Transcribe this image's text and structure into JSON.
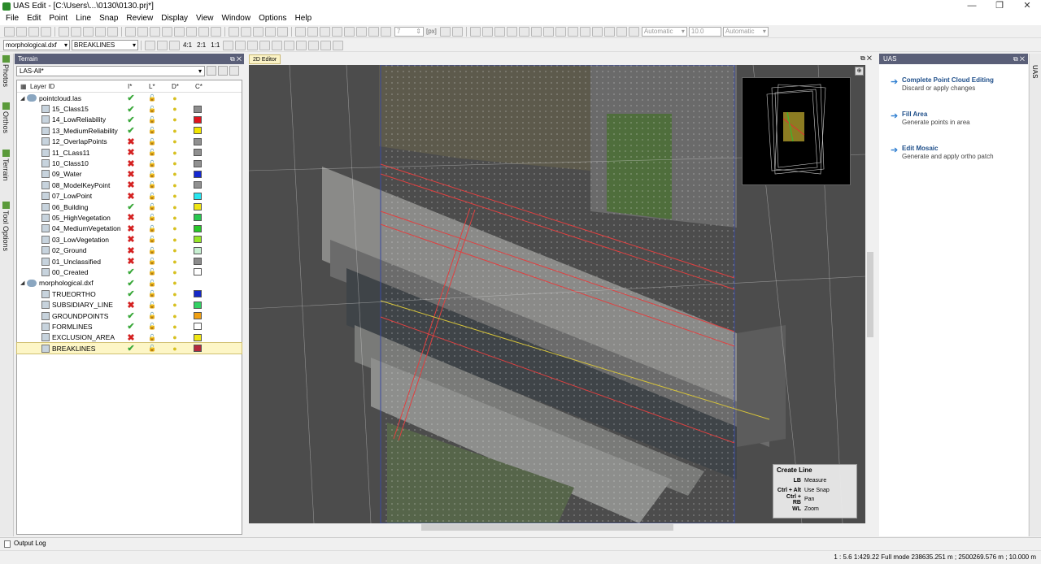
{
  "window": {
    "title": "UAS Edit - [C:\\Users\\...\\0130\\0130.prj*]",
    "minimize": "—",
    "restore": "❐",
    "close": "✕"
  },
  "menu": [
    "File",
    "Edit",
    "Point",
    "Line",
    "Snap",
    "Review",
    "Display",
    "View",
    "Window",
    "Options",
    "Help"
  ],
  "toolbar": {
    "spacing_value": "7",
    "spacing_unit": "[px]",
    "mode1": "Automatic",
    "value": "10.0",
    "mode2": "Automatic"
  },
  "toolbar2": {
    "file_select": "morphological.dxf",
    "layer_select": "BREAKLINES",
    "zoom_labels": [
      "4:1",
      "2:1",
      "1:1"
    ]
  },
  "left_tabs": [
    "Photos",
    "Orthos",
    "Terrain",
    "Tool Options"
  ],
  "terrain_panel": {
    "title": "Terrain",
    "filter": "LAS-All*",
    "columns": {
      "name": "Layer ID",
      "i": "I*",
      "l": "L*",
      "d": "D*",
      "c": "C*"
    },
    "groups": [
      {
        "name": "pointcloud.las",
        "layers": [
          {
            "name": "15_Class15",
            "visible": true,
            "color": "#8c8c8c"
          },
          {
            "name": "14_LowReliability",
            "visible": true,
            "color": "#e0141e"
          },
          {
            "name": "13_MediumReliability",
            "visible": true,
            "color": "#f2e600"
          },
          {
            "name": "12_OverlapPoints",
            "visible": false,
            "color": "#909090"
          },
          {
            "name": "11_CLass11",
            "visible": false,
            "color": "#909090"
          },
          {
            "name": "10_Class10",
            "visible": false,
            "color": "#909090"
          },
          {
            "name": "09_Water",
            "visible": false,
            "color": "#1428d2"
          },
          {
            "name": "08_ModelKeyPoint",
            "visible": false,
            "color": "#909090"
          },
          {
            "name": "07_LowPoint",
            "visible": false,
            "color": "#28e6f0"
          },
          {
            "name": "06_Building",
            "visible": true,
            "color": "#f0e614"
          },
          {
            "name": "05_HighVegetation",
            "visible": false,
            "color": "#28c850"
          },
          {
            "name": "04_MediumVegetation",
            "visible": false,
            "color": "#28c828"
          },
          {
            "name": "03_LowVegetation",
            "visible": false,
            "color": "#96e628"
          },
          {
            "name": "02_Ground",
            "visible": false,
            "color": "#c8f0d2"
          },
          {
            "name": "01_Unclassified",
            "visible": false,
            "color": "#8c8c8c"
          },
          {
            "name": "00_Created",
            "visible": true,
            "color": "#ffffff"
          }
        ]
      },
      {
        "name": "morphological.dxf",
        "layers": [
          {
            "name": "TRUEORTHO",
            "visible": true,
            "color": "#1428c8"
          },
          {
            "name": "SUBSIDIARY_LINE",
            "visible": false,
            "color": "#32d264"
          },
          {
            "name": "GROUNDPOINTS",
            "visible": true,
            "color": "#f0a014"
          },
          {
            "name": "FORMLINES",
            "visible": true,
            "color": "#ffffff"
          },
          {
            "name": "EXCLUSION_AREA",
            "visible": false,
            "color": "#f0e614"
          },
          {
            "name": "BREAKLINES",
            "visible": true,
            "color": "#b4283c",
            "selected": true
          }
        ]
      }
    ]
  },
  "editor": {
    "tab": "2D Editor",
    "shortcuts": {
      "title": "Create Line",
      "items": [
        {
          "key": "LB",
          "action": "Measure"
        },
        {
          "key": "Ctrl + Alt",
          "action": "Use Snap"
        },
        {
          "key": "Ctrl + RB",
          "action": "Pan"
        },
        {
          "key": "WL",
          "action": "Zoom"
        }
      ]
    }
  },
  "uas_panel": {
    "title": "UAS",
    "items": [
      {
        "title": "Complete Point Cloud Editing",
        "desc": "Discard or apply changes"
      },
      {
        "title": "Fill Area",
        "desc": "Generate points in area"
      },
      {
        "title": "Edit Mosaic",
        "desc": "Generate and apply ortho patch"
      }
    ]
  },
  "right_tab": "UAS",
  "output_log": "Output Log",
  "status": "1 : 5.6   1:429.22   Full mode   238635.251 m ; 2500269.576 m ; 10.000 m",
  "colors": {
    "panel_header": "#5a5f78",
    "accent": "#2b7cd0",
    "selected_row": "#fdf6c6"
  }
}
